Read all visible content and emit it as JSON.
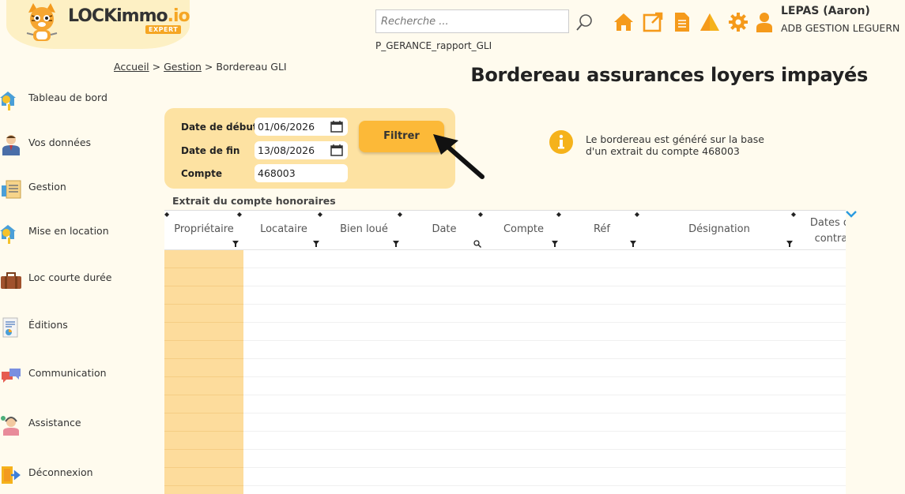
{
  "header": {
    "logo_main": "LOCKimmo",
    "logo_suffix": ".io",
    "logo_badge": "EXPERT",
    "search_placeholder": "Recherche ...",
    "page_code": "P_GERANCE_rapport_GLI",
    "user_name": "LEPAS (Aaron)",
    "user_company": "ADB GESTION LEGUERN",
    "icons": [
      "search-icon",
      "home-icon",
      "external-link-icon",
      "document-icon",
      "alert-icon",
      "gear-icon",
      "user-icon"
    ]
  },
  "breadcrumb": {
    "home": "Accueil",
    "sep1": ">",
    "section": "Gestion",
    "sep2": ">",
    "current": "Bordereau GLI"
  },
  "page_title": "Bordereau assurances loyers impayés",
  "sidebar": {
    "items": [
      {
        "label": "Tableau de bord",
        "icon": "house-key-icon"
      },
      {
        "label": "Vos données",
        "icon": "person-icon"
      },
      {
        "label": "Gestion",
        "icon": "clipboard-icon"
      },
      {
        "label": "Mise en location",
        "icon": "house-key-icon"
      },
      {
        "label": "Loc courte durée",
        "icon": "suitcase-icon"
      },
      {
        "label": "Éditions",
        "icon": "report-icon"
      },
      {
        "label": "Communication",
        "icon": "chat-icon"
      },
      {
        "label": "Assistance",
        "icon": "support-icon"
      },
      {
        "label": "Déconnexion",
        "icon": "logout-icon"
      }
    ]
  },
  "filter": {
    "start_label": "Date de début",
    "start_value": "01/06/2026",
    "end_label": "Date de fin",
    "end_value": "13/08/2026",
    "account_label": "Compte",
    "account_value": "468003",
    "button_label": "Filtrer"
  },
  "info": {
    "line1": "Le bordereau est généré sur la base",
    "line2": "d'un extrait du compte 468003"
  },
  "table": {
    "caption": "Extrait du compte honoraires",
    "columns": [
      "Propriétaire",
      "Locataire",
      "Bien loué",
      "Date",
      "Compte",
      "Réf",
      "Désignation",
      "Dates de contrat"
    ],
    "sort_glyph": "▲▼"
  },
  "colors": {
    "background": "#fffbee",
    "accent": "#f5a623",
    "panel": "#fde2a2",
    "button": "#fcb938",
    "first_column": "#fddc9c"
  }
}
